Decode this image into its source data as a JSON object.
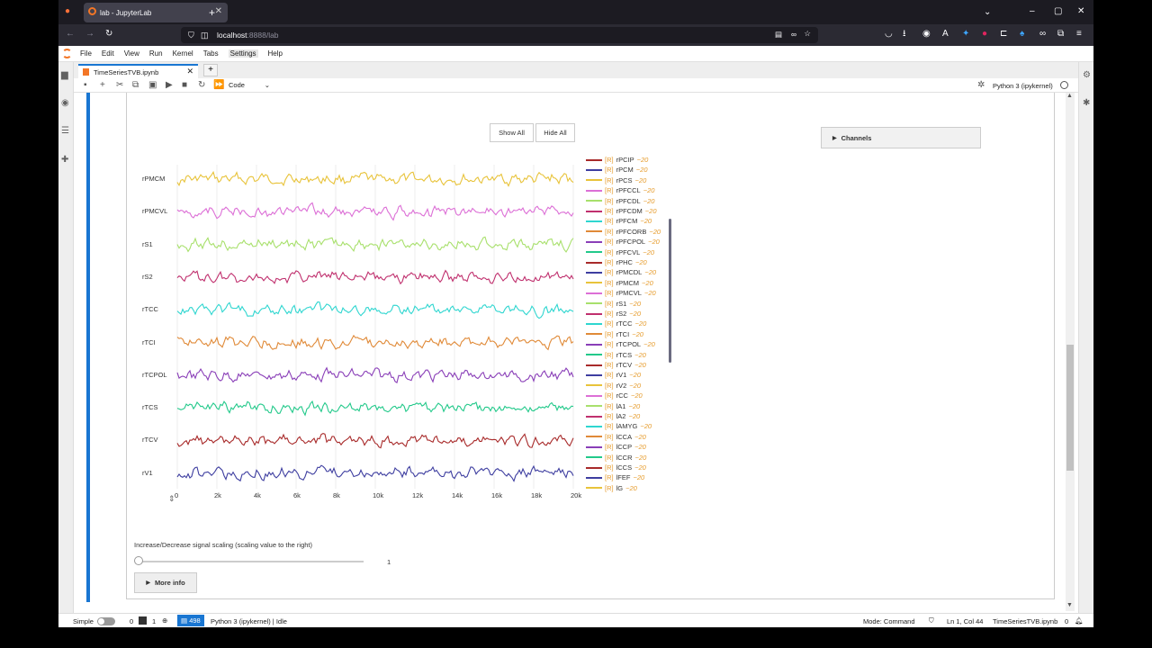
{
  "browser": {
    "tab_title": "lab - JupyterLab",
    "url_host": "localhost",
    "url_rest": ":8888/lab"
  },
  "menu": [
    "File",
    "Edit",
    "View",
    "Run",
    "Kernel",
    "Tabs",
    "Settings",
    "Help"
  ],
  "notebook": {
    "tab_name": "TimeSeriesTVB.ipynb",
    "cell_type": "Code",
    "kernel": "Python 3 (ipykernel)"
  },
  "widget": {
    "show_all": "Show All",
    "hide_all": "Hide All",
    "channels": "Channels",
    "slider_label": "Increase/Decrease signal scaling (scaling value to the right)",
    "slider_value": "1",
    "slider_fraction": 0,
    "more_info": "More info"
  },
  "chart_data": {
    "type": "line",
    "channels": [
      "rPMCM",
      "rPMCVL",
      "rS1",
      "rS2",
      "rTCC",
      "rTCI",
      "rTCPOL",
      "rTCS",
      "rTCV",
      "rV1"
    ],
    "channel_colors": [
      "#e8c33a",
      "#dc6fd6",
      "#a8e06c",
      "#c0306e",
      "#2fd6d0",
      "#e08a38",
      "#8a3fb8",
      "#22c98a",
      "#a82a2a",
      "#3e3ea0"
    ],
    "x_ticks": [
      "0",
      "2k",
      "4k",
      "6k",
      "8k",
      "10k",
      "12k",
      "14k",
      "16k",
      "18k",
      "20k"
    ],
    "xlim": [
      0,
      20000
    ],
    "legend": [
      {
        "tag": "[R]",
        "name": "rPCIP",
        "scale": "~20",
        "color": "#a82a2a"
      },
      {
        "tag": "[R]",
        "name": "rPCM",
        "scale": "~20",
        "color": "#3e3ea0"
      },
      {
        "tag": "[R]",
        "name": "rPCS",
        "scale": "~20",
        "color": "#e8c33a"
      },
      {
        "tag": "[R]",
        "name": "rPFCCL",
        "scale": "~20",
        "color": "#dc6fd6"
      },
      {
        "tag": "[R]",
        "name": "rPFCDL",
        "scale": "~20",
        "color": "#a8e06c"
      },
      {
        "tag": "[R]",
        "name": "rPFCDM",
        "scale": "~20",
        "color": "#c0306e"
      },
      {
        "tag": "[R]",
        "name": "rPFCM",
        "scale": "~20",
        "color": "#2fd6d0"
      },
      {
        "tag": "[R]",
        "name": "rPFCORB",
        "scale": "~20",
        "color": "#e08a38"
      },
      {
        "tag": "[R]",
        "name": "rPFCPOL",
        "scale": "~20",
        "color": "#8a3fb8"
      },
      {
        "tag": "[R]",
        "name": "rPFCVL",
        "scale": "~20",
        "color": "#22c98a"
      },
      {
        "tag": "[R]",
        "name": "rPHC",
        "scale": "~20",
        "color": "#a82a2a"
      },
      {
        "tag": "[R]",
        "name": "rPMCDL",
        "scale": "~20",
        "color": "#3e3ea0"
      },
      {
        "tag": "[R]",
        "name": "rPMCM",
        "scale": "~20",
        "color": "#e8c33a"
      },
      {
        "tag": "[R]",
        "name": "rPMCVL",
        "scale": "~20",
        "color": "#dc6fd6"
      },
      {
        "tag": "[R]",
        "name": "rS1",
        "scale": "~20",
        "color": "#a8e06c"
      },
      {
        "tag": "[R]",
        "name": "rS2",
        "scale": "~20",
        "color": "#c0306e"
      },
      {
        "tag": "[R]",
        "name": "rTCC",
        "scale": "~20",
        "color": "#2fd6d0"
      },
      {
        "tag": "[R]",
        "name": "rTCI",
        "scale": "~20",
        "color": "#e08a38"
      },
      {
        "tag": "[R]",
        "name": "rTCPOL",
        "scale": "~20",
        "color": "#8a3fb8"
      },
      {
        "tag": "[R]",
        "name": "rTCS",
        "scale": "~20",
        "color": "#22c98a"
      },
      {
        "tag": "[R]",
        "name": "rTCV",
        "scale": "~20",
        "color": "#a82a2a"
      },
      {
        "tag": "[R]",
        "name": "rV1",
        "scale": "~20",
        "color": "#3e3ea0"
      },
      {
        "tag": "[R]",
        "name": "rV2",
        "scale": "~20",
        "color": "#e8c33a"
      },
      {
        "tag": "[R]",
        "name": "rCC",
        "scale": "~20",
        "color": "#dc6fd6"
      },
      {
        "tag": "[R]",
        "name": "lA1",
        "scale": "~20",
        "color": "#a8e06c"
      },
      {
        "tag": "[R]",
        "name": "lA2",
        "scale": "~20",
        "color": "#c0306e"
      },
      {
        "tag": "[R]",
        "name": "lAMYG",
        "scale": "~20",
        "color": "#2fd6d0"
      },
      {
        "tag": "[R]",
        "name": "lCCA",
        "scale": "~20",
        "color": "#e08a38"
      },
      {
        "tag": "[R]",
        "name": "lCCP",
        "scale": "~20",
        "color": "#8a3fb8"
      },
      {
        "tag": "[R]",
        "name": "lCCR",
        "scale": "~20",
        "color": "#22c98a"
      },
      {
        "tag": "[R]",
        "name": "lCCS",
        "scale": "~20",
        "color": "#a82a2a"
      },
      {
        "tag": "[R]",
        "name": "lFEF",
        "scale": "~20",
        "color": "#3e3ea0"
      },
      {
        "tag": "[R]",
        "name": "lG",
        "scale": "~20",
        "color": "#e8c33a"
      }
    ]
  },
  "status": {
    "mode_label": "Simple",
    "count_a": "0",
    "count_b": "1",
    "mem": "498",
    "kernel_state": "Python 3 (ipykernel) | Idle",
    "mode": "Mode: Command",
    "position": "Ln 1, Col 44",
    "file": "TimeSeriesTVB.ipynb",
    "notif": "0"
  }
}
